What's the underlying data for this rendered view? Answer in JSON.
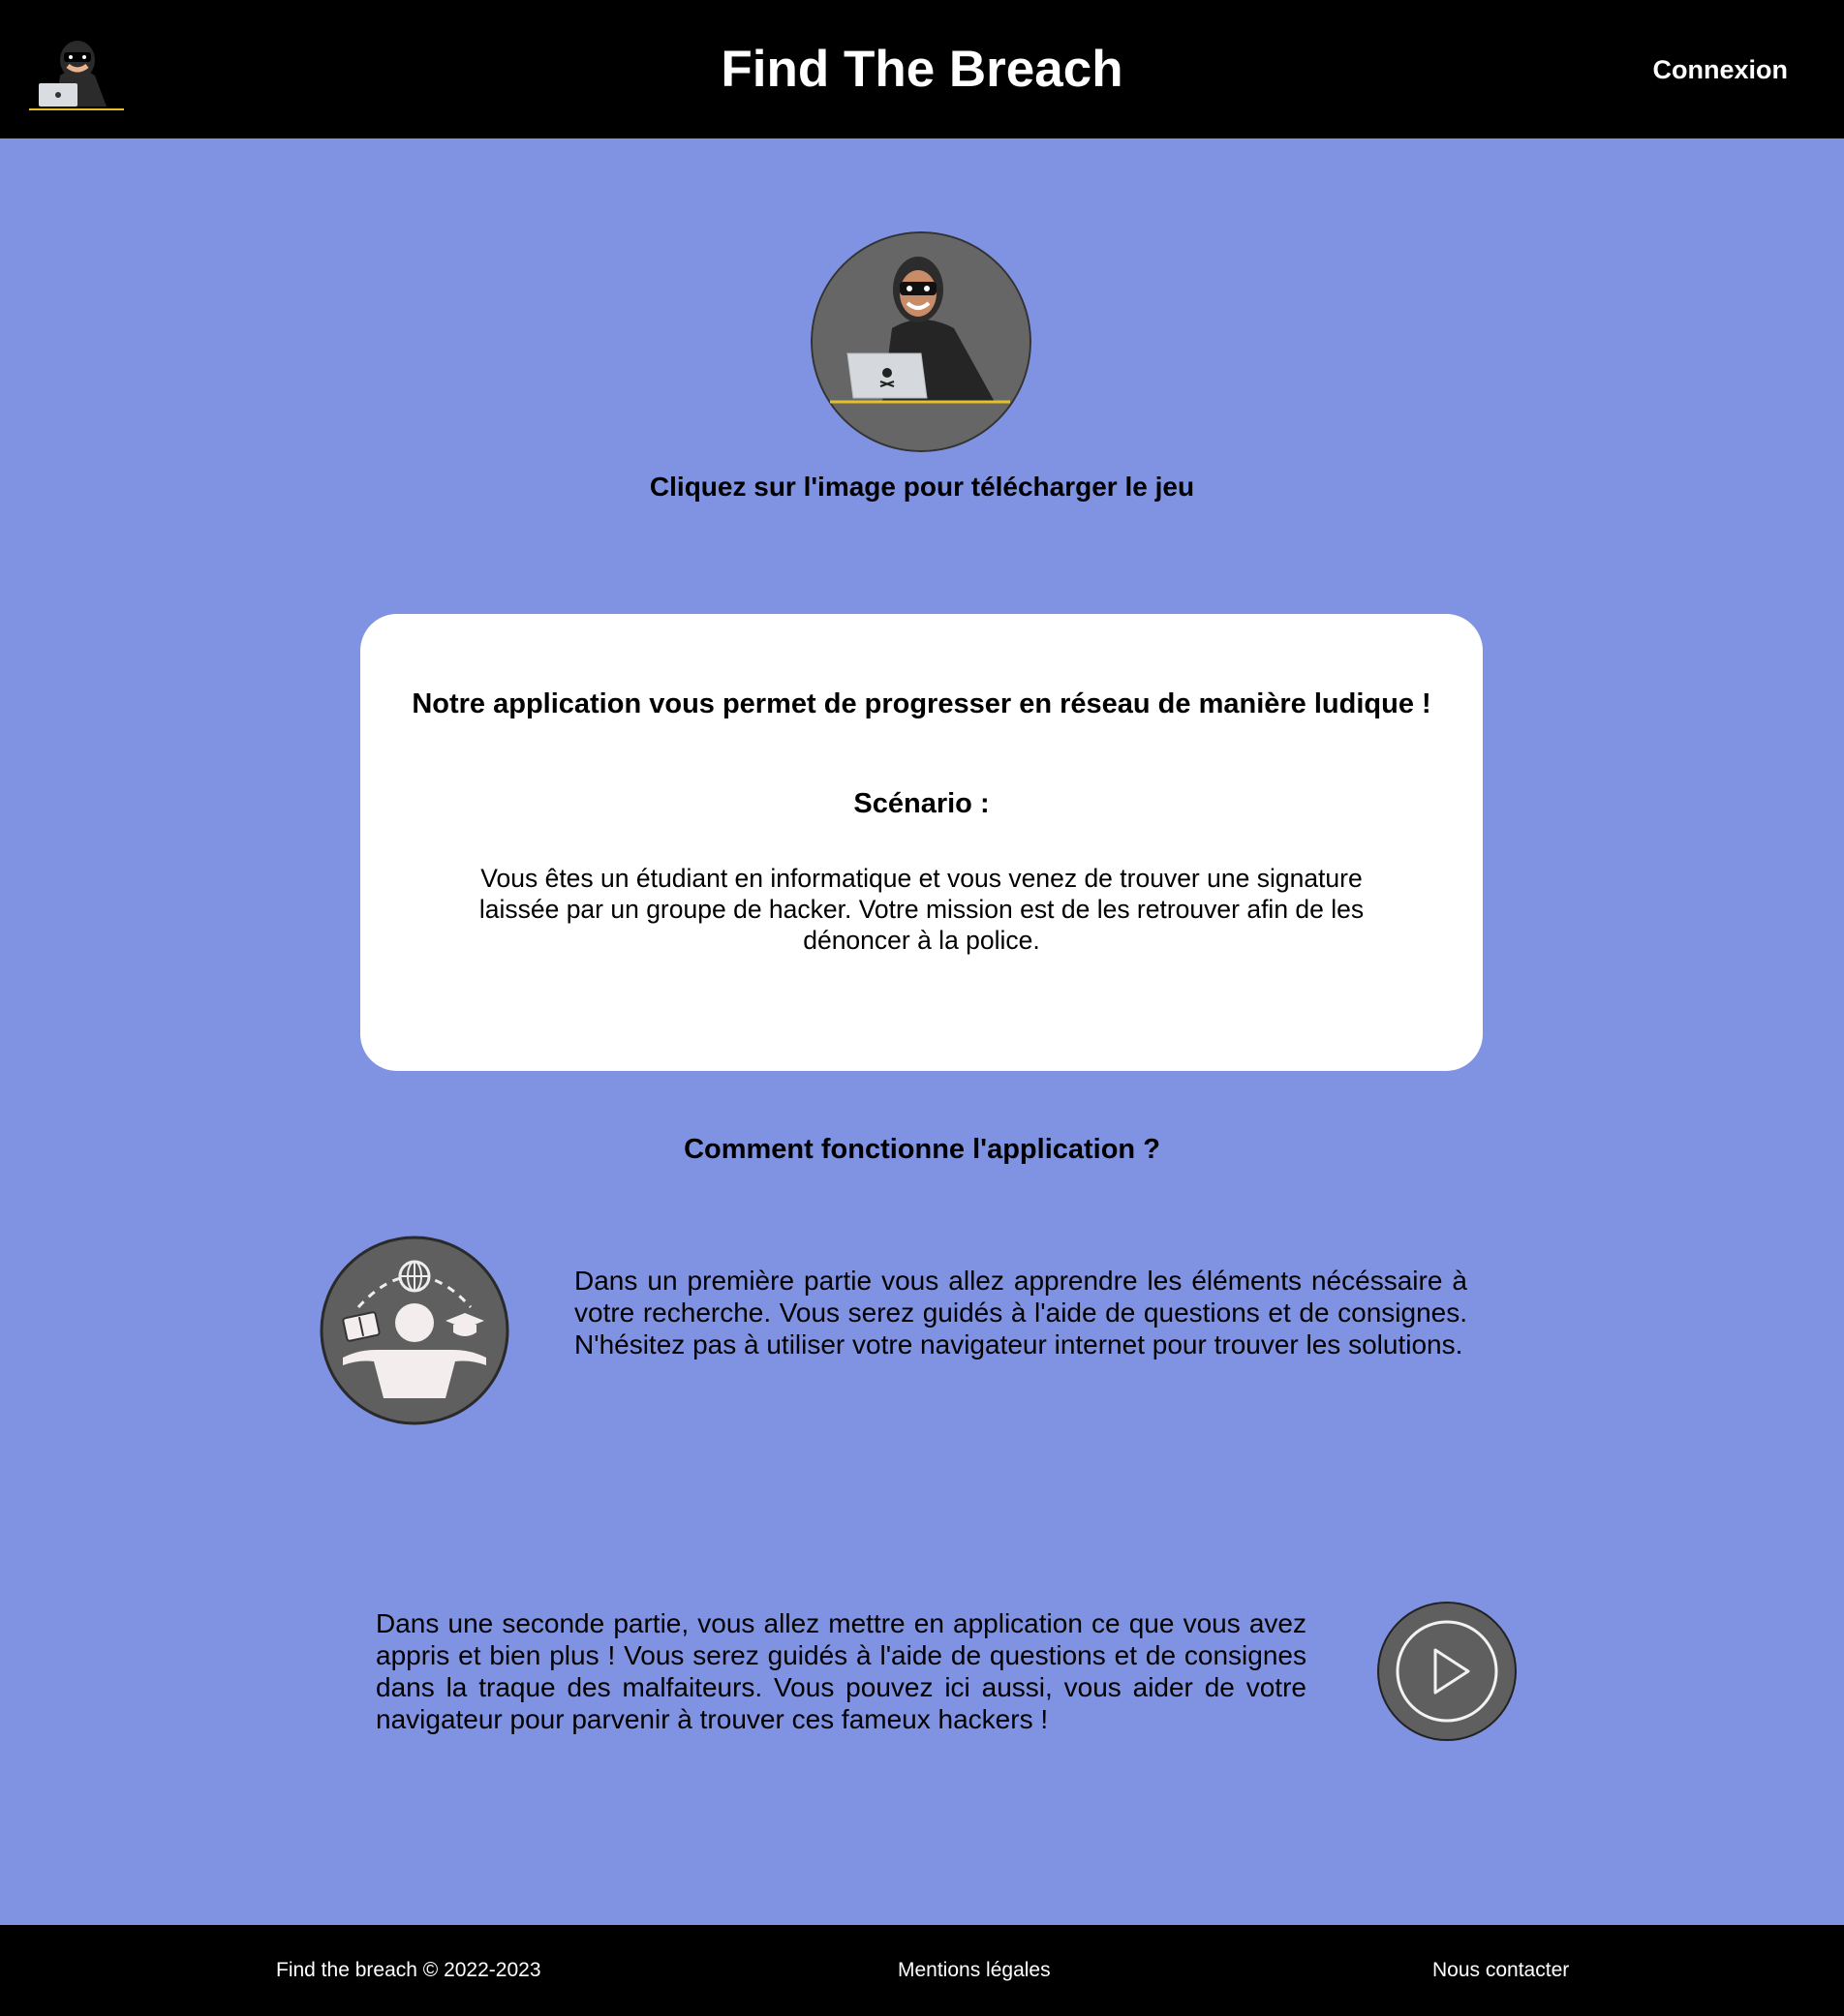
{
  "header": {
    "title": "Find The Breach",
    "login_label": "Connexion"
  },
  "hero": {
    "caption": "Cliquez sur l'image pour télécharger le jeu"
  },
  "card": {
    "heading": "Notre application vous permet de progresser en réseau de manière ludique !",
    "scenario_title": "Scénario :",
    "scenario_text": "Vous êtes un étudiant en informatique et vous venez de trouver une signature laissée par un groupe de hacker. Votre mission est de les retrouver afin de les dénoncer à la police."
  },
  "how": {
    "title": "Comment fonctionne l'application ?",
    "step1_text": "Dans un première partie vous allez apprendre les éléments nécéssaire à votre recherche. Vous serez guidés à l'aide de questions et de consignes. N'hésitez pas à utiliser votre navigateur internet pour trouver les solutions.",
    "step2_text": "Dans une seconde partie, vous allez mettre en application ce que vous avez appris et bien plus ! Vous serez guidés à l'aide de questions et de consignes dans la traque des malfaiteurs. Vous pouvez ici aussi, vous aider de votre navigateur pour parvenir à trouver ces fameux hackers !"
  },
  "footer": {
    "copyright": "Find the breach © 2022-2023",
    "legal": "Mentions légales",
    "contact": "Nous contacter"
  },
  "icons": {
    "logo": "hacker-logo-icon",
    "hero": "hacker-download-icon",
    "step1": "learning-student-icon",
    "step2": "play-icon"
  },
  "colors": {
    "background": "#7f93e2",
    "header": "#000000",
    "card": "#ffffff",
    "icon_circle": "#5f5f5f"
  }
}
